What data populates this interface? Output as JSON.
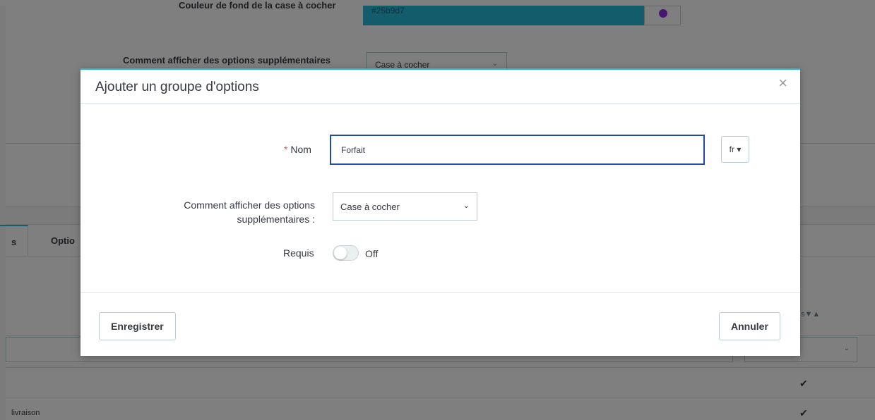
{
  "background": {
    "color_label": "Couleur de fond de la case à cocher",
    "color_value": "#25b9d7",
    "display_label": "Comment afficher des options supplémentaires",
    "display_select": "Case à cocher",
    "tabs": [
      "s",
      "Optio"
    ],
    "column_sort": "s▼▲",
    "rows": [
      {
        "text": "",
        "checked": "✔"
      },
      {
        "text": "livraison",
        "checked": "✔"
      }
    ]
  },
  "modal": {
    "title": "Ajouter un groupe d'options",
    "close_symbol": "×",
    "fields": {
      "name": {
        "required_mark": "*",
        "label": "Nom",
        "value": "Forfait",
        "language": "fr ▾"
      },
      "display": {
        "label_line1": "Comment afficher des options",
        "label_line2": "supplémentaires :",
        "selected": "Case à cocher",
        "chevron": "⌄"
      },
      "required": {
        "label": "Requis",
        "state": "Off"
      }
    },
    "footer": {
      "save_label": "Enregistrer",
      "cancel_label": "Annuler"
    }
  },
  "colors": {
    "accent": "#25b9d7",
    "focus_border": "#1f4ba5",
    "required_star": "#c05c67",
    "text": "#363a41"
  }
}
